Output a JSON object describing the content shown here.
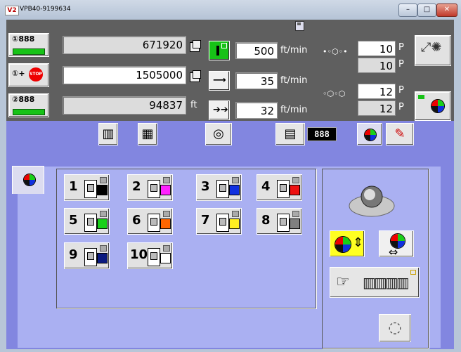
{
  "window": {
    "title": "VPB40-9199634",
    "icon_text": "V2",
    "icon_color": "#b00000"
  },
  "buttons_window": [
    "minimize-icon",
    "maximize-icon",
    "close-icon"
  ],
  "counters": {
    "c1_label": "①888",
    "c1_value": "671920",
    "stop_label": "①+",
    "stop_text": "STOP",
    "c2_label": "1505000",
    "c3_label": "②888",
    "c3_value": "94837",
    "c3_unit": "ft"
  },
  "speeds": [
    {
      "value": "500",
      "unit": "ft/min"
    },
    {
      "value": "35",
      "unit": "ft/min"
    },
    {
      "value": "32",
      "unit": "ft/min"
    }
  ],
  "pins": [
    {
      "value": "10",
      "unit": "P"
    },
    {
      "value": "10",
      "unit": "P"
    },
    {
      "value": "12",
      "unit": "P"
    },
    {
      "value": "12",
      "unit": "P"
    }
  ],
  "led_text": "888",
  "color_buttons": [
    {
      "num": "1",
      "color": "#000000"
    },
    {
      "num": "2",
      "color": "#ff22ff"
    },
    {
      "num": "3",
      "color": "#1030e0"
    },
    {
      "num": "4",
      "color": "#ee1111"
    },
    {
      "num": "5",
      "color": "#18d018"
    },
    {
      "num": "6",
      "color": "#ff6600"
    },
    {
      "num": "7",
      "color": "#ffee22"
    },
    {
      "num": "8",
      "color": "#808080"
    },
    {
      "num": "9",
      "color": "#0a1a80"
    },
    {
      "num": "10",
      "color": "#ffffff"
    }
  ],
  "colors": {
    "panel": "#5f5f5f",
    "workspace": "#8286e0",
    "inner": "#aab0f2",
    "green": "#17c217",
    "yellow": "#ffff22"
  }
}
